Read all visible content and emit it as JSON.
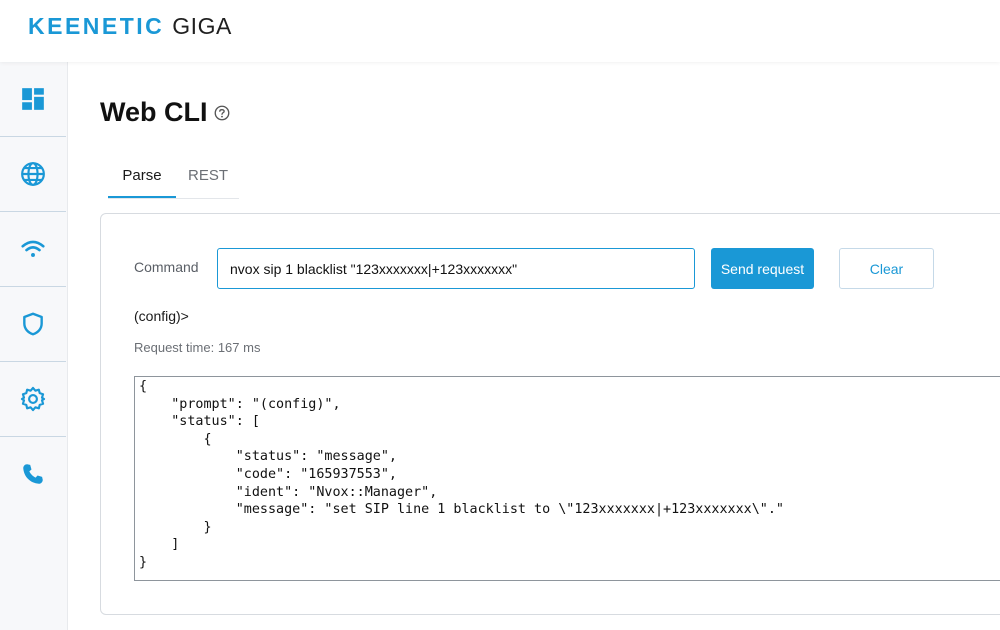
{
  "header": {
    "brand": "KEENETIC",
    "model": "GIGA"
  },
  "sidebar": {
    "items": [
      {
        "icon": "dashboard-icon"
      },
      {
        "icon": "globe-icon"
      },
      {
        "icon": "wifi-icon"
      },
      {
        "icon": "shield-icon"
      },
      {
        "icon": "gear-icon"
      },
      {
        "icon": "phone-icon"
      }
    ]
  },
  "page": {
    "title": "Web CLI",
    "help_icon": "help-circle-icon"
  },
  "tabs": [
    {
      "label": "Parse",
      "active": true
    },
    {
      "label": "REST",
      "active": false
    }
  ],
  "command": {
    "label": "Command",
    "value": "nvox sip 1 blacklist \"123xxxxxxx|+123xxxxxxx\"",
    "send_label": "Send request",
    "clear_label": "Clear"
  },
  "output": {
    "prompt": "(config)>",
    "request_time_label": "Request time:",
    "request_time_value": "167 ms",
    "json": "{\n    \"prompt\": \"(config)\",\n    \"status\": [\n        {\n            \"status\": \"message\",\n            \"code\": \"165937553\",\n            \"ident\": \"Nvox::Manager\",\n            \"message\": \"set SIP line 1 blacklist to \\\"123xxxxxxx|+123xxxxxxx\\\".\"\n        }\n    ]\n}"
  },
  "colors": {
    "accent": "#1a98d6",
    "text": "#1a1a1a",
    "muted": "#6b6f75"
  }
}
